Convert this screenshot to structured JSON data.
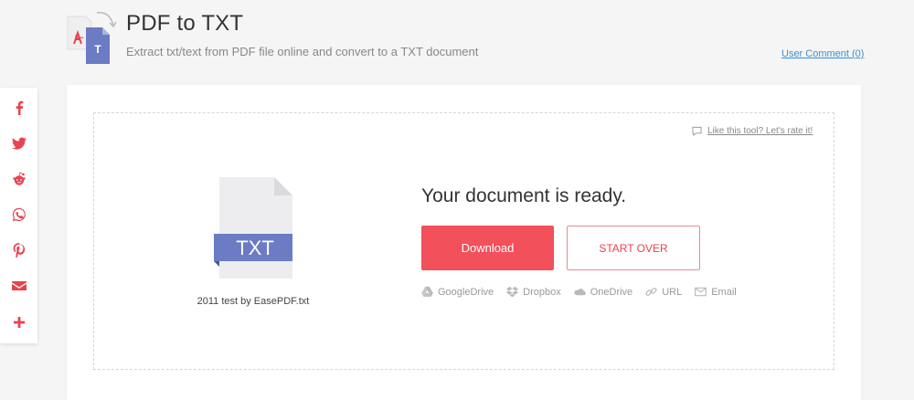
{
  "header": {
    "title": "PDF to TXT",
    "subtitle": "Extract txt/text from PDF file online and convert to a TXT document",
    "user_comment": "User Comment (0)",
    "icon_letter": "T"
  },
  "social": {
    "items": [
      "facebook-icon",
      "twitter-icon",
      "reddit-icon",
      "whatsapp-icon",
      "pinterest-icon",
      "email-icon",
      "plus-icon"
    ]
  },
  "main": {
    "rate_link": "Like this tool? Let's rate it!",
    "file_badge": "TXT",
    "file_name": "2011 test by EasePDF.txt",
    "ready_title": "Your document is ready.",
    "download_label": "Download",
    "start_over_label": "START OVER",
    "share_targets": [
      {
        "icon": "google-drive-icon",
        "label": "GoogleDrive"
      },
      {
        "icon": "dropbox-icon",
        "label": "Dropbox"
      },
      {
        "icon": "onedrive-icon",
        "label": "OneDrive"
      },
      {
        "icon": "link-icon",
        "label": "URL"
      },
      {
        "icon": "email-icon",
        "label": "Email"
      }
    ]
  },
  "colors": {
    "accent": "#f2505a",
    "social": "#e84350",
    "link": "#3b8fd6",
    "file_badge": "#6b7bc4"
  }
}
